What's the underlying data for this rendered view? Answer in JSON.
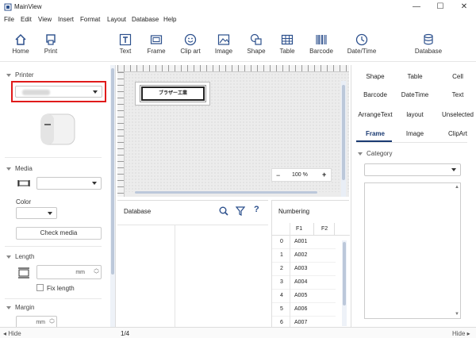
{
  "window": {
    "title": "MainView"
  },
  "menu": [
    "File",
    "Edit",
    "View",
    "Insert",
    "Format",
    "Layout",
    "Database",
    "Help"
  ],
  "toolbar": {
    "home": "Home",
    "print": "Print",
    "text": "Text",
    "frame": "Frame",
    "clip_art": "Clip art",
    "image": "Image",
    "shape": "Shape",
    "table": "Table",
    "barcode": "Barcode",
    "date_time": "Date/Time",
    "database": "Database"
  },
  "left_panel": {
    "printer_label": "Printer",
    "media_label": "Media",
    "color_label": "Color",
    "check_media": "Check media",
    "length_label": "Length",
    "length_unit": "mm",
    "fix_length": "Fix length",
    "margin_label": "Margin",
    "margin_unit": "mm"
  },
  "canvas": {
    "label_text": "ブラザー工業",
    "zoom": "100 %",
    "zoom_out": "−",
    "zoom_in": "+"
  },
  "right_panel": {
    "tabs_row1": [
      "Shape",
      "Table",
      "Cell"
    ],
    "tabs_row2": [
      "Barcode",
      "DateTime",
      "Text"
    ],
    "tabs_row3": [
      "ArrangeText",
      "layout",
      "Unselected"
    ],
    "tabs_row4": [
      "Frame",
      "Image",
      "ClipArt"
    ],
    "category_label": "Category"
  },
  "database": {
    "title": "Database"
  },
  "numbering": {
    "title": "Numbering",
    "columns": [
      "F1",
      "F2"
    ],
    "rows": [
      {
        "n": "0",
        "f1": "A001"
      },
      {
        "n": "1",
        "f1": "A002"
      },
      {
        "n": "2",
        "f1": "A003"
      },
      {
        "n": "3",
        "f1": "A004"
      },
      {
        "n": "4",
        "f1": "A005"
      },
      {
        "n": "5",
        "f1": "A006"
      },
      {
        "n": "6",
        "f1": "A007"
      }
    ]
  },
  "status": {
    "hide_left": "Hide",
    "page": "1/4",
    "hide_right": "Hide"
  },
  "colors": {
    "accent": "#1a3a72",
    "highlight": "#e01b1b",
    "icon": "#2b4f8c"
  }
}
